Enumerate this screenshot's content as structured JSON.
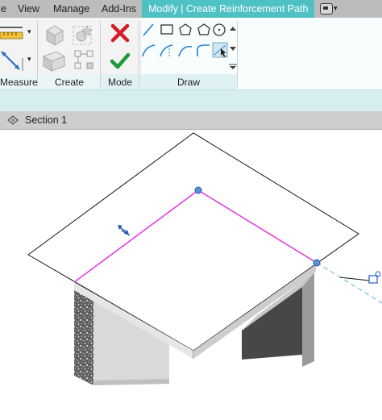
{
  "ribbon": {
    "tabs": [
      {
        "label": "e",
        "active": false
      },
      {
        "label": "View",
        "active": false
      },
      {
        "label": "Manage",
        "active": false
      },
      {
        "label": "Add-Ins",
        "active": false
      },
      {
        "label": "Modify | Create Reinforcement Path",
        "active": true
      }
    ],
    "panels": {
      "measure": "Measure",
      "create": "Create",
      "mode": "Mode",
      "draw": "Draw"
    },
    "colors": {
      "active_tab": "#4ec1c4",
      "cancel": "#d0202a",
      "finish": "#1e9a3c",
      "draw_tool": "#2a7fc9"
    }
  },
  "view": {
    "title": "Section 1"
  },
  "canvas": {
    "path_color": "#e040e0",
    "grip_color": "#5b8fd6"
  }
}
